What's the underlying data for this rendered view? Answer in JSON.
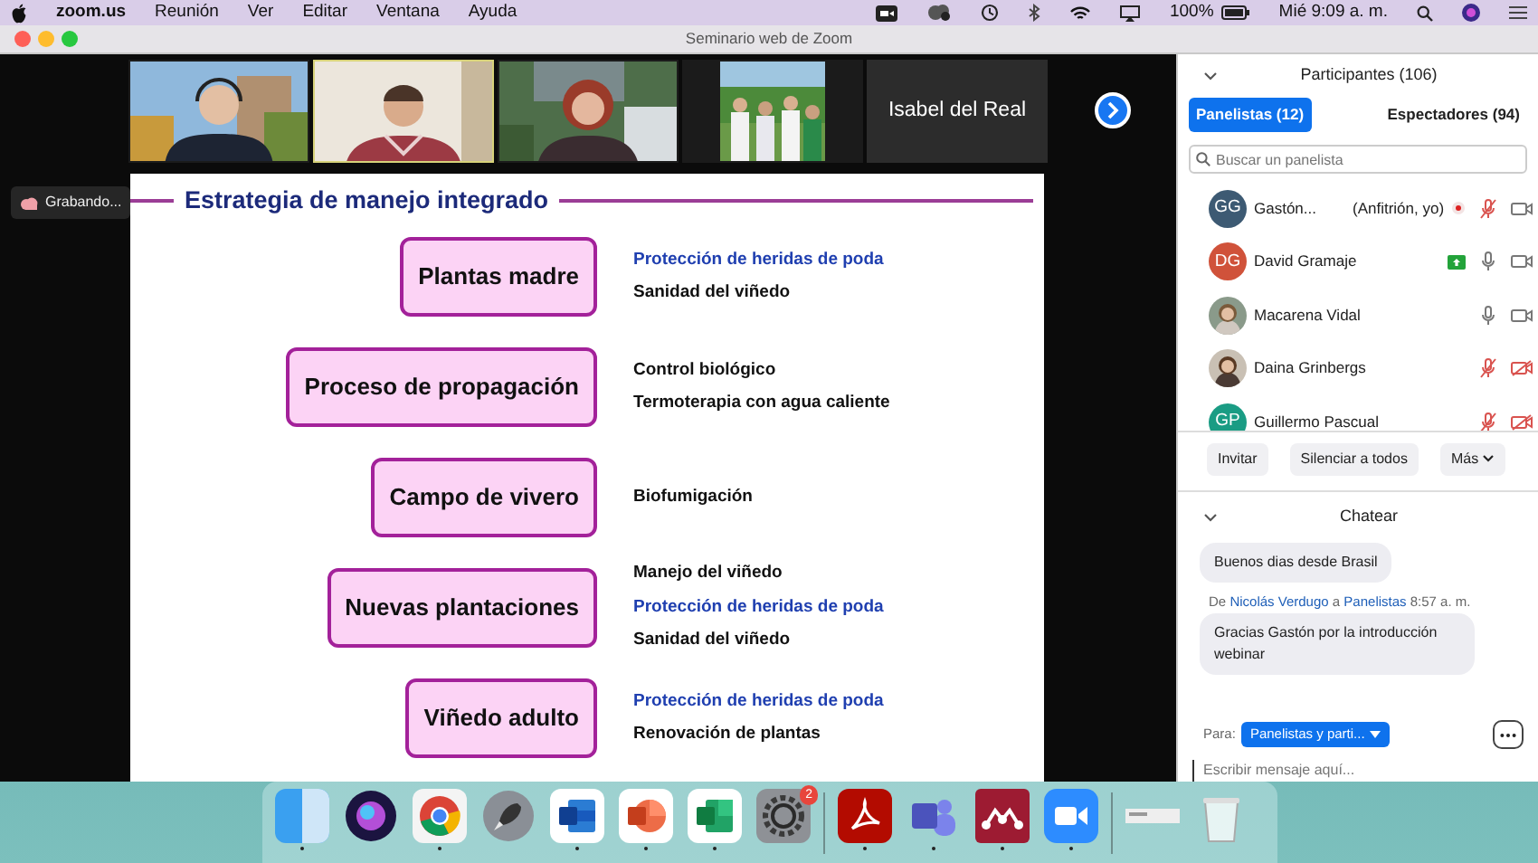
{
  "menu_bar": {
    "app": "zoom.us",
    "menus": [
      "Reunión",
      "Ver",
      "Editar",
      "Ventana",
      "Ayuda"
    ],
    "battery": "100%",
    "clock": "Mié 9:09 a. m."
  },
  "window": {
    "title": "Seminario web de Zoom"
  },
  "video_strip": {
    "tiles": [
      {
        "kind": "picture",
        "speaking": false
      },
      {
        "kind": "picture",
        "speaking": true
      },
      {
        "kind": "picture",
        "speaking": false
      },
      {
        "kind": "picture",
        "speaking": false
      },
      {
        "kind": "name",
        "name": "Isabel del Real",
        "speaking": false
      }
    ]
  },
  "recording_badge": "Grabando...",
  "slide": {
    "title": "Estrategia de manejo integrado",
    "rows": [
      {
        "stage": "Plantas madre",
        "items": [
          {
            "text": "Protección de heridas de poda",
            "kind": "emphasis"
          },
          {
            "text": "Sanidad del viñedo",
            "kind": "plain"
          }
        ]
      },
      {
        "stage": "Proceso de propagación",
        "items": [
          {
            "text": "Control biológico",
            "kind": "plain"
          },
          {
            "text": "Termoterapia con agua caliente",
            "kind": "plain"
          }
        ]
      },
      {
        "stage": "Campo de vivero",
        "items": [
          {
            "text": "Biofumigación",
            "kind": "plain"
          }
        ]
      },
      {
        "stage": "Nuevas plantaciones",
        "items": [
          {
            "text": "Manejo del viñedo",
            "kind": "plain"
          },
          {
            "text": "Protección de heridas de poda",
            "kind": "emphasis"
          },
          {
            "text": "Sanidad del viñedo",
            "kind": "plain"
          }
        ]
      },
      {
        "stage": "Viñedo adulto",
        "items": [
          {
            "text": "Protección de heridas de poda",
            "kind": "emphasis"
          },
          {
            "text": "Renovación de plantas",
            "kind": "plain"
          }
        ]
      }
    ]
  },
  "participants": {
    "title": "Participantes (106)",
    "tabs": [
      {
        "label": "Panelistas (12)",
        "selected": true
      },
      {
        "label": "Espectadores (94)",
        "selected": false
      }
    ],
    "search": {
      "placeholder": "Buscar un panelista"
    },
    "list": [
      {
        "avatar": {
          "kind": "initials",
          "text": "GG",
          "color": "#3d5a73"
        },
        "name": "Gastón...",
        "role": "(Anfitrión, yo)",
        "recording": true,
        "sharing": false,
        "mic_muted": true,
        "video_off": false
      },
      {
        "avatar": {
          "kind": "initials",
          "text": "DG",
          "color": "#d0523a"
        },
        "name": "David Gramaje",
        "recording": false,
        "sharing": true,
        "mic_muted": false,
        "video_off": false
      },
      {
        "avatar": {
          "kind": "picture"
        },
        "name": "Macarena Vidal",
        "recording": false,
        "sharing": false,
        "mic_muted": false,
        "video_off": false
      },
      {
        "avatar": {
          "kind": "picture"
        },
        "name": "Daina Grinbergs",
        "recording": false,
        "sharing": false,
        "mic_muted": true,
        "video_off": true
      },
      {
        "avatar": {
          "kind": "initials",
          "text": "GP",
          "color": "#1a9c84"
        },
        "name": "Guillermo Pascual",
        "recording": false,
        "sharing": false,
        "mic_muted": true,
        "video_off": true
      }
    ],
    "buttons": [
      "Invitar",
      "Silenciar a todos",
      "Más"
    ]
  },
  "chat": {
    "title": "Chatear",
    "messages": [
      {
        "kind": "bubble",
        "text": "Buenos dias desde Brasil"
      },
      {
        "kind": "header",
        "prefix": "De",
        "sender": "Nicolás Verdugo",
        "joiner": "a",
        "recipient": "Panelistas",
        "time": "8:57 a. m."
      },
      {
        "kind": "bubble",
        "text": "Gracias Gastón por la introducción webinar"
      }
    ],
    "to_label": "Para:",
    "to_value": "Panelistas y parti...",
    "input": {
      "placeholder": "Escribir mensaje aquí..."
    }
  },
  "dock": {
    "apps": [
      {
        "kind": "finder",
        "running": true
      },
      {
        "kind": "siri",
        "running": false
      },
      {
        "kind": "chrome",
        "running": true
      },
      {
        "kind": "launchpad",
        "running": false
      },
      {
        "kind": "word",
        "running": true
      },
      {
        "kind": "powerpoint",
        "running": true
      },
      {
        "kind": "excel",
        "running": true
      },
      {
        "kind": "settings",
        "running": false,
        "badge": "2"
      },
      {
        "kind": "separator"
      },
      {
        "kind": "acrobat",
        "running": true
      },
      {
        "kind": "teams",
        "running": true
      },
      {
        "kind": "mendeley",
        "running": true
      },
      {
        "kind": "zoom",
        "running": true
      },
      {
        "kind": "separator"
      },
      {
        "kind": "window",
        "running": false
      },
      {
        "kind": "trash",
        "running": false
      }
    ]
  }
}
